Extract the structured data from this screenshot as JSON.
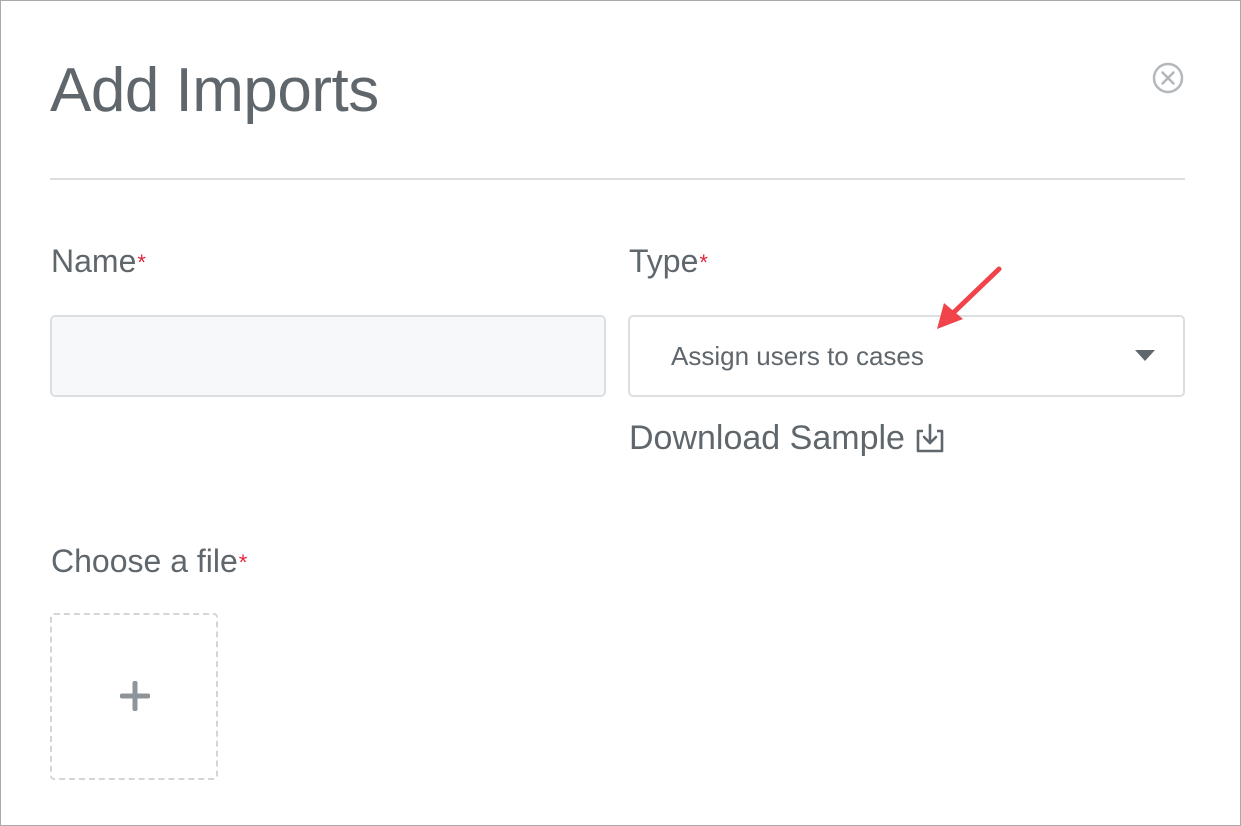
{
  "dialog": {
    "title": "Add Imports",
    "close_icon": "close-circle-icon"
  },
  "form": {
    "name": {
      "label": "Name",
      "required_mark": "*",
      "value": "",
      "placeholder": ""
    },
    "type": {
      "label": "Type",
      "required_mark": "*",
      "selected_value": "Assign users to cases",
      "dropdown_icon": "caret-down-icon"
    },
    "download_sample": {
      "label": "Download Sample",
      "icon": "download-icon"
    },
    "file": {
      "label": "Choose a file",
      "required_mark": "*",
      "add_icon": "plus-icon"
    }
  },
  "annotation": {
    "arrow_color": "#f0444a"
  },
  "colors": {
    "text": "#5f676d",
    "required": "#e0263c",
    "border": "#dcdfe2",
    "input_bg": "#f7f8fa"
  }
}
